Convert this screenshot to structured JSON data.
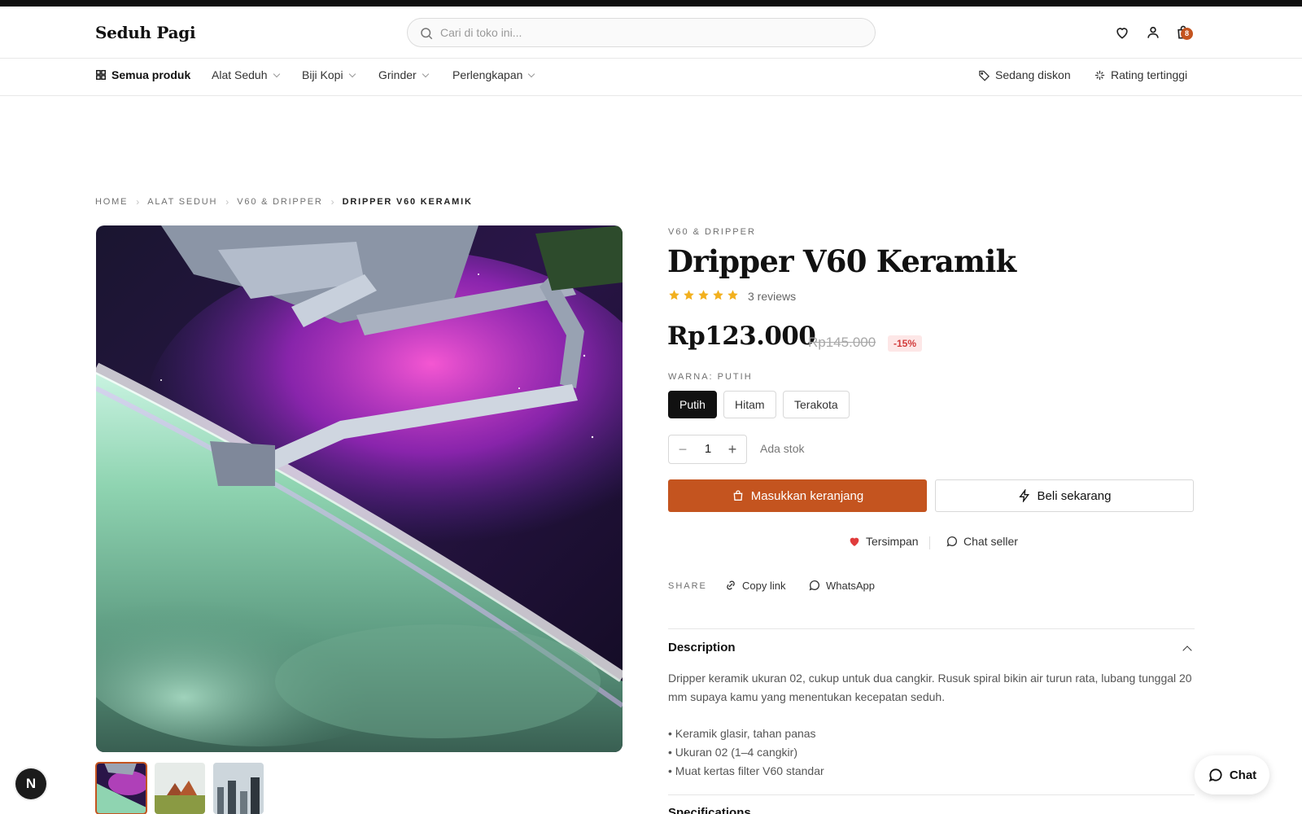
{
  "header": {
    "logo": "Seduh Pagi",
    "search_placeholder": "Cari di toko ini...",
    "cart_count": "8",
    "icons": [
      "search-icon",
      "heart-icon",
      "user-icon",
      "cart-icon"
    ]
  },
  "nav": {
    "all_products": "Semua produk",
    "items": [
      {
        "label": "Alat Seduh"
      },
      {
        "label": "Biji Kopi"
      },
      {
        "label": "Grinder"
      },
      {
        "label": "Perlengkapan"
      }
    ],
    "right_items": [
      {
        "label": "Sedang diskon",
        "icon": "tag-icon"
      },
      {
        "label": "Rating tertinggi",
        "icon": "sparkle-icon"
      }
    ]
  },
  "breadcrumb": [
    "HOME",
    "ALAT SEDUH",
    "V60 & DRIPPER",
    "DRIPPER V60 KERAMIK"
  ],
  "gallery": {
    "active_index": 0,
    "thumbnail_count": 3
  },
  "product": {
    "category": "V60 & DRIPPER",
    "title": "Dripper V60 Keramik",
    "rating": 5,
    "rating_max": 5,
    "reviews": "3 reviews",
    "price": "Rp123.000",
    "old_price": "Rp145.000",
    "discount": "-15%",
    "color_label": "WARNA: PUTIH",
    "colors": [
      {
        "label": "Putih",
        "selected": true
      },
      {
        "label": "Hitam",
        "selected": false
      },
      {
        "label": "Terakota",
        "selected": false
      }
    ],
    "quantity": "1",
    "stock": "Ada stok",
    "add_to_cart": "Masukkan keranjang",
    "buy_now": "Beli sekarang",
    "saved": "Tersimpan",
    "chat_seller": "Chat seller",
    "share_label": "SHARE",
    "copy_link": "Copy link",
    "whatsapp": "WhatsApp"
  },
  "description": {
    "title": "Description",
    "text": "Dripper keramik ukuran 02, cukup untuk dua cangkir. Rusuk spiral bikin air turun rata, lubang tunggal 20 mm supaya kamu yang menentukan kecepatan seduh.",
    "bullets": [
      "• Keramik glasir, tahan panas",
      "• Ukuran 02 (1–4 cangkir)",
      "• Muat kertas filter V60 standar"
    ]
  },
  "specifications": {
    "title": "Specifications"
  },
  "floating": {
    "badge_letter": "N",
    "chat_label": "Chat"
  },
  "colors": {
    "accent": "#c4541f",
    "dark": "#111111",
    "discount_bg": "#fde7e7",
    "discount_text": "#d23b3b",
    "star": "#f2b01e"
  }
}
